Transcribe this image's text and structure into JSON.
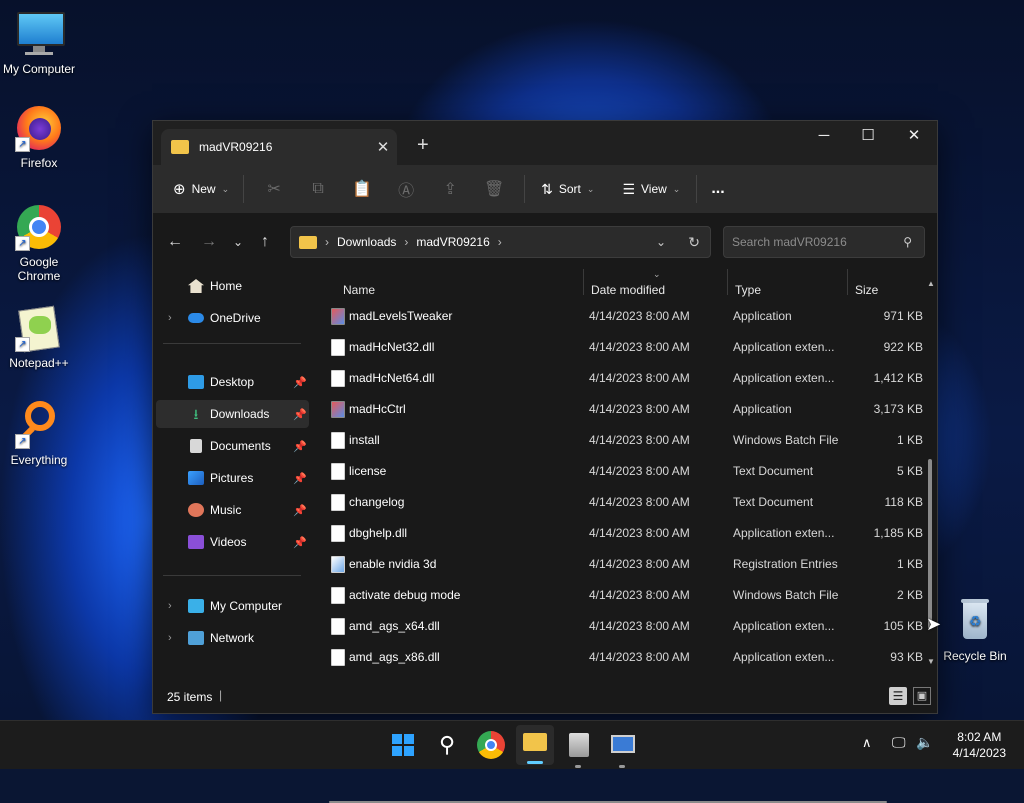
{
  "desktop": {
    "icons": [
      {
        "label": "My Computer"
      },
      {
        "label": "Firefox"
      },
      {
        "label": "Google Chrome"
      },
      {
        "label": "Notepad++"
      },
      {
        "label": "Everything"
      },
      {
        "label": "Recycle Bin"
      }
    ]
  },
  "window": {
    "tab_title": "madVR09216",
    "toolbar": {
      "new_label": "New",
      "sort_label": "Sort",
      "view_label": "View",
      "more_label": "..."
    },
    "address": {
      "crumbs": [
        "Downloads",
        "madVR09216"
      ],
      "search_placeholder": "Search madVR09216"
    },
    "sidebar": {
      "items": [
        {
          "label": "Home"
        },
        {
          "label": "OneDrive"
        },
        {
          "label": "Desktop"
        },
        {
          "label": "Downloads"
        },
        {
          "label": "Documents"
        },
        {
          "label": "Pictures"
        },
        {
          "label": "Music"
        },
        {
          "label": "Videos"
        },
        {
          "label": "My Computer"
        },
        {
          "label": "Network"
        }
      ]
    },
    "columns": {
      "name": "Name",
      "date": "Date modified",
      "type": "Type",
      "size": "Size"
    },
    "files": [
      {
        "name": "madLevelsTweaker",
        "date": "4/14/2023 8:00 AM",
        "type": "Application",
        "size": "971 KB"
      },
      {
        "name": "madHcNet32.dll",
        "date": "4/14/2023 8:00 AM",
        "type": "Application exten...",
        "size": "922 KB"
      },
      {
        "name": "madHcNet64.dll",
        "date": "4/14/2023 8:00 AM",
        "type": "Application exten...",
        "size": "1,412 KB"
      },
      {
        "name": "madHcCtrl",
        "date": "4/14/2023 8:00 AM",
        "type": "Application",
        "size": "3,173 KB"
      },
      {
        "name": "install",
        "date": "4/14/2023 8:00 AM",
        "type": "Windows Batch File",
        "size": "1 KB"
      },
      {
        "name": "license",
        "date": "4/14/2023 8:00 AM",
        "type": "Text Document",
        "size": "5 KB"
      },
      {
        "name": "changelog",
        "date": "4/14/2023 8:00 AM",
        "type": "Text Document",
        "size": "118 KB"
      },
      {
        "name": "dbghelp.dll",
        "date": "4/14/2023 8:00 AM",
        "type": "Application exten...",
        "size": "1,185 KB"
      },
      {
        "name": "enable nvidia 3d",
        "date": "4/14/2023 8:00 AM",
        "type": "Registration Entries",
        "size": "1 KB"
      },
      {
        "name": "activate debug mode",
        "date": "4/14/2023 8:00 AM",
        "type": "Windows Batch File",
        "size": "2 KB"
      },
      {
        "name": "amd_ags_x64.dll",
        "date": "4/14/2023 8:00 AM",
        "type": "Application exten...",
        "size": "105 KB"
      },
      {
        "name": "amd_ags_x86.dll",
        "date": "4/14/2023 8:00 AM",
        "type": "Application exten...",
        "size": "93 KB"
      }
    ],
    "status": {
      "count": "25 items"
    }
  },
  "taskbar": {
    "time": "8:02 AM",
    "date": "4/14/2023"
  },
  "colors": {
    "accent": "#60cdff",
    "folder": "#f2c44a"
  }
}
